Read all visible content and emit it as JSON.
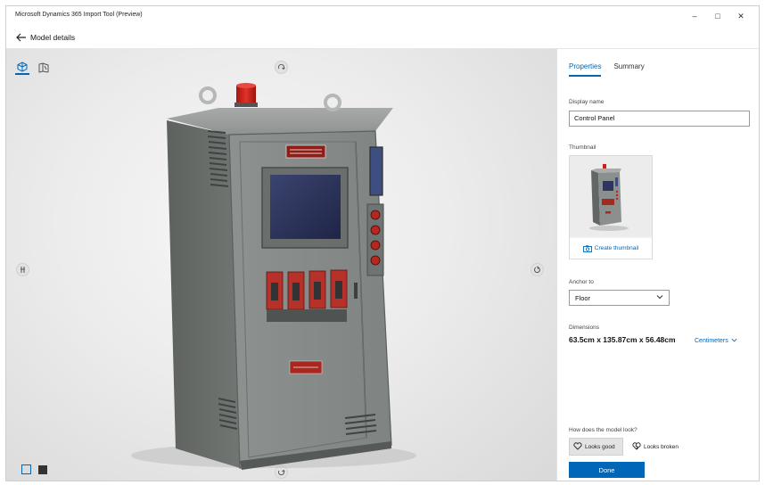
{
  "window": {
    "title": "Microsoft Dynamics 365 Import Tool (Preview)",
    "minimize_glyph": "–",
    "restore_glyph": "□",
    "close_glyph": "✕"
  },
  "header": {
    "back_icon": "back-arrow-icon",
    "page_title": "Model details"
  },
  "viewport": {
    "toolbar_icons": [
      "3d-view-icon",
      "wireframe-view-icon"
    ],
    "rotate_icons": [
      "rotate-up-icon",
      "rotate-left-icon",
      "rotate-right-icon",
      "rotate-down-icon"
    ],
    "background_swatches": [
      "light-background-swatch",
      "dark-background-swatch"
    ]
  },
  "panel": {
    "tabs": [
      {
        "label": "Properties",
        "active": true
      },
      {
        "label": "Summary",
        "active": false
      }
    ],
    "display_name_label": "Display name",
    "display_name_value": "Control Panel",
    "thumbnail_label": "Thumbnail",
    "create_thumbnail": "Create thumbnail",
    "anchor_label": "Anchor to",
    "anchor_value": "Floor",
    "dimensions_label": "Dimensions",
    "dimensions_value": "63.5cm x 135.87cm x 56.48cm",
    "units_value": "Centimeters",
    "feedback_question": "How does the model look?",
    "looks_good": "Looks good",
    "looks_broken": "Looks broken",
    "done": "Done"
  },
  "colors": {
    "accent": "#0067b8",
    "cabinet": "#8a8f8c",
    "beacon": "#c8211b"
  }
}
